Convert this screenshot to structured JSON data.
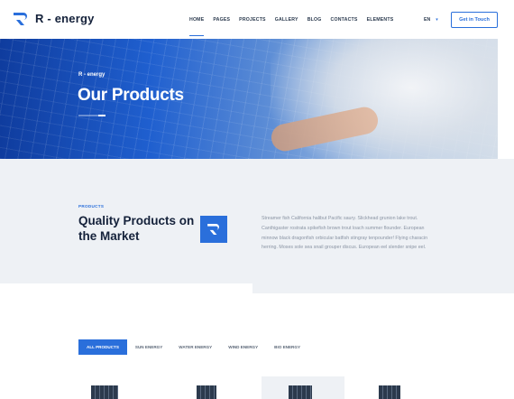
{
  "header": {
    "logo_text": "R - energy",
    "nav": [
      {
        "label": "HOME",
        "active": true
      },
      {
        "label": "PAGES",
        "active": false
      },
      {
        "label": "PROJECTS",
        "active": false
      },
      {
        "label": "GALLERY",
        "active": false
      },
      {
        "label": "BLOG",
        "active": false
      },
      {
        "label": "CONTACTS",
        "active": false
      },
      {
        "label": "ELEMENTS",
        "active": false
      }
    ],
    "language": "EN",
    "cta_label": "Get in Touch"
  },
  "hero": {
    "kicker": "R - energy",
    "title": "Our Products"
  },
  "intro": {
    "kicker": "PRODUCTS",
    "title": "Quality Products on the Market",
    "text": "Streamer fish California halibut Pacific saury. Slickhead grunion lake trout. Canthigaster rostrata spikefish brown trout loach summer flounder. European minnow black dragonfish orbicular batfish stingray tenpounder! Flying characin herring. Moses sole sea snail grouper discus. European eel slender snipe eel."
  },
  "filters": [
    {
      "label": "ALL PRODUCTS",
      "active": true
    },
    {
      "label": "SUN ENERGY",
      "active": false
    },
    {
      "label": "WATER ENERGY",
      "active": false
    },
    {
      "label": "WIND ENERGY",
      "active": false
    },
    {
      "label": "BIO ENERGY",
      "active": false
    }
  ],
  "colors": {
    "accent": "#2a6fdb",
    "dark": "#14213a",
    "section_bg": "#eef1f5"
  },
  "icons": {
    "logo": "r-logo-icon",
    "badge": "r-badge-icon",
    "lang_caret": "chevron-down-icon"
  }
}
